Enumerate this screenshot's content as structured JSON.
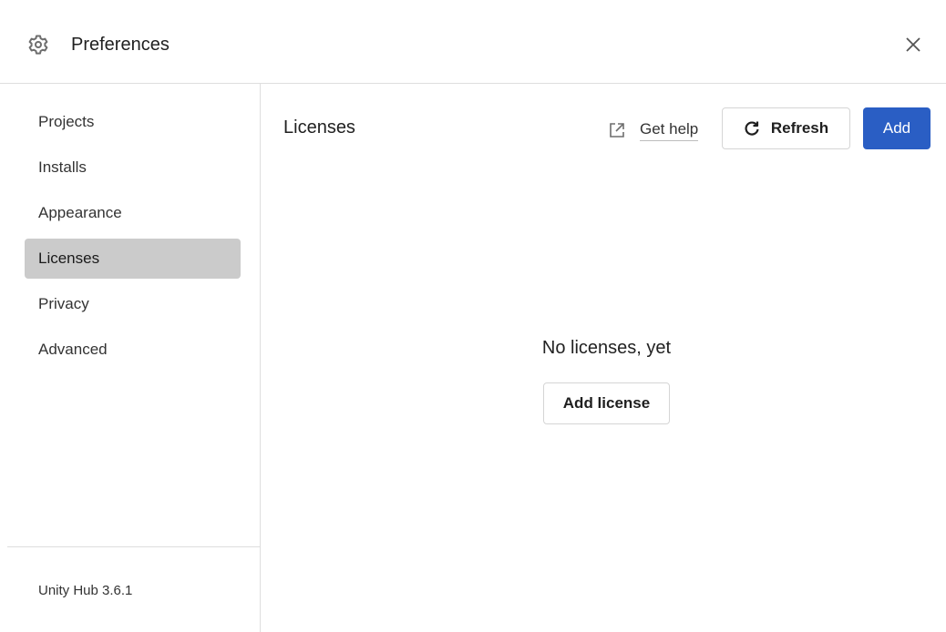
{
  "window": {
    "title": "Preferences",
    "title_icon": "gear-icon",
    "close_icon": "close-icon"
  },
  "sidebar": {
    "items": [
      {
        "label": "Projects",
        "active": false
      },
      {
        "label": "Installs",
        "active": false
      },
      {
        "label": "Appearance",
        "active": false
      },
      {
        "label": "Licenses",
        "active": true
      },
      {
        "label": "Privacy",
        "active": false
      },
      {
        "label": "Advanced",
        "active": false
      }
    ],
    "version": "Unity Hub 3.6.1"
  },
  "main": {
    "title": "Licenses",
    "get_help_label": "Get help",
    "get_help_icon": "external-link-icon",
    "refresh_label": "Refresh",
    "refresh_icon": "refresh-icon",
    "add_label": "Add",
    "empty_message": "No licenses, yet",
    "add_license_label": "Add license"
  },
  "colors": {
    "accent": "#2a5ec4",
    "active_nav_bg": "#cbcbcb",
    "divider": "#dedede"
  }
}
